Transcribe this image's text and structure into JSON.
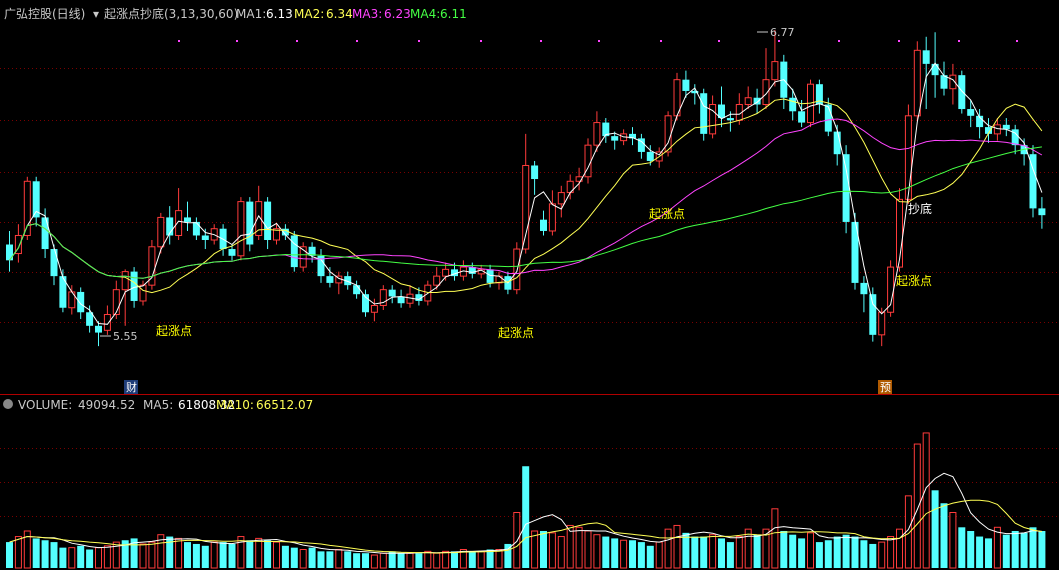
{
  "header": {
    "stock_label": "广弘控股(日线)",
    "indicator_label": "起涨点抄底(3,13,30,60)",
    "ma1_label": "MA1:",
    "ma1_value": "6.13",
    "ma2_label": "MA2:",
    "ma2_value": "6.34",
    "ma3_label": "MA3:",
    "ma3_value": "6.23",
    "ma4_label": "MA4:",
    "ma4_value": "6.11"
  },
  "volume_header": {
    "volume_label": "VOLUME:",
    "volume_value": "49094.52",
    "ma5_label": "MA5:",
    "ma5_value": "61808.32",
    "ma10_label": "MA10:",
    "ma10_value": "66512.07"
  },
  "markers": {
    "fin": "财",
    "pre": "预"
  },
  "colors": {
    "up": "#FF3B3B",
    "down": "#54FFFF",
    "ma1": "#FFFFFF",
    "ma2": "#FFFF55",
    "ma3": "#FF44FF",
    "ma4": "#44FF44",
    "grid": "#7A0000",
    "label_yellow": "#FFFF00",
    "text": "#C8C8C8"
  },
  "chart_data": {
    "type": "candlestick",
    "price_range": [
      5.4,
      6.95
    ],
    "volume_range": [
      0,
      160000
    ],
    "high_label": "6.77",
    "low_label": "5.55",
    "annotations": [
      "起涨点",
      "起涨点",
      "起涨点",
      "起涨点",
      "抄底"
    ],
    "candles": [
      [
        6.0,
        5.93,
        6.06,
        5.88
      ],
      [
        5.96,
        6.04,
        6.09,
        5.92
      ],
      [
        6.04,
        6.28,
        6.3,
        6.02
      ],
      [
        6.28,
        6.12,
        6.3,
        6.08
      ],
      [
        6.12,
        5.98,
        6.16,
        5.94
      ],
      [
        5.98,
        5.86,
        6.0,
        5.82
      ],
      [
        5.86,
        5.72,
        5.89,
        5.7
      ],
      [
        5.72,
        5.79,
        5.82,
        5.69
      ],
      [
        5.79,
        5.7,
        5.81,
        5.67
      ],
      [
        5.7,
        5.64,
        5.73,
        5.61
      ],
      [
        5.64,
        5.61,
        5.66,
        5.55
      ],
      [
        5.62,
        5.69,
        5.73,
        5.6
      ],
      [
        5.69,
        5.8,
        5.84,
        5.67
      ],
      [
        5.8,
        5.88,
        5.89,
        5.64
      ],
      [
        5.88,
        5.75,
        5.9,
        5.72
      ],
      [
        5.75,
        5.82,
        5.84,
        5.73
      ],
      [
        5.82,
        5.99,
        6.02,
        5.8
      ],
      [
        5.99,
        6.12,
        6.14,
        5.96
      ],
      [
        6.12,
        6.04,
        6.17,
        6.0
      ],
      [
        6.04,
        6.15,
        6.25,
        6.02
      ],
      [
        6.12,
        6.1,
        6.19,
        6.06
      ],
      [
        6.1,
        6.04,
        6.12,
        6.02
      ],
      [
        6.04,
        6.02,
        6.07,
        5.98
      ],
      [
        6.02,
        6.07,
        6.09,
        6.0
      ],
      [
        6.07,
        5.98,
        6.09,
        5.95
      ],
      [
        5.98,
        5.95,
        6.0,
        5.93
      ],
      [
        5.95,
        6.19,
        6.21,
        5.93
      ],
      [
        6.19,
        6.0,
        6.21,
        5.97
      ],
      [
        6.04,
        6.19,
        6.26,
        6.02
      ],
      [
        6.19,
        6.02,
        6.21,
        5.98
      ],
      [
        6.02,
        6.07,
        6.09,
        6.0
      ],
      [
        6.07,
        6.04,
        6.09,
        6.02
      ],
      [
        6.04,
        5.9,
        6.06,
        5.88
      ],
      [
        5.9,
        5.99,
        6.01,
        5.88
      ],
      [
        5.99,
        5.95,
        6.01,
        5.92
      ],
      [
        5.95,
        5.86,
        5.98,
        5.83
      ],
      [
        5.86,
        5.83,
        5.9,
        5.81
      ],
      [
        5.83,
        5.86,
        5.88,
        5.78
      ],
      [
        5.86,
        5.82,
        5.88,
        5.8
      ],
      [
        5.82,
        5.78,
        5.84,
        5.76
      ],
      [
        5.78,
        5.7,
        5.8,
        5.68
      ],
      [
        5.7,
        5.73,
        5.76,
        5.66
      ],
      [
        5.73,
        5.8,
        5.82,
        5.71
      ],
      [
        5.8,
        5.77,
        5.82,
        5.74
      ],
      [
        5.77,
        5.74,
        5.8,
        5.72
      ],
      [
        5.74,
        5.78,
        5.82,
        5.72
      ],
      [
        5.78,
        5.75,
        5.81,
        5.73
      ],
      [
        5.75,
        5.82,
        5.84,
        5.73
      ],
      [
        5.82,
        5.86,
        5.9,
        5.8
      ],
      [
        5.86,
        5.89,
        5.92,
        5.84
      ],
      [
        5.89,
        5.86,
        5.92,
        5.84
      ],
      [
        5.86,
        5.9,
        5.93,
        5.84
      ],
      [
        5.9,
        5.87,
        5.92,
        5.85
      ],
      [
        5.87,
        5.89,
        5.91,
        5.85
      ],
      [
        5.89,
        5.83,
        5.91,
        5.81
      ],
      [
        5.83,
        5.86,
        5.88,
        5.8
      ],
      [
        5.86,
        5.8,
        5.88,
        5.78
      ],
      [
        5.8,
        5.98,
        6.01,
        5.78
      ],
      [
        5.98,
        6.35,
        6.49,
        5.96
      ],
      [
        6.35,
        6.29,
        6.37,
        6.22
      ],
      [
        6.11,
        6.06,
        6.15,
        6.04
      ],
      [
        6.06,
        6.18,
        6.24,
        6.04
      ],
      [
        6.18,
        6.23,
        6.26,
        6.12
      ],
      [
        6.23,
        6.28,
        6.31,
        6.2
      ],
      [
        6.28,
        6.3,
        6.34,
        6.24
      ],
      [
        6.3,
        6.44,
        6.47,
        6.27
      ],
      [
        6.44,
        6.54,
        6.59,
        6.41
      ],
      [
        6.54,
        6.48,
        6.56,
        6.45
      ],
      [
        6.48,
        6.46,
        6.5,
        6.42
      ],
      [
        6.46,
        6.49,
        6.51,
        6.44
      ],
      [
        6.49,
        6.47,
        6.52,
        6.44
      ],
      [
        6.47,
        6.41,
        6.49,
        6.38
      ],
      [
        6.41,
        6.37,
        6.44,
        6.35
      ],
      [
        6.37,
        6.41,
        6.43,
        6.34
      ],
      [
        6.41,
        6.57,
        6.59,
        6.39
      ],
      [
        6.57,
        6.73,
        6.76,
        6.55
      ],
      [
        6.73,
        6.68,
        6.77,
        6.65
      ],
      [
        6.68,
        6.67,
        6.71,
        6.62
      ],
      [
        6.67,
        6.49,
        6.69,
        6.46
      ],
      [
        6.49,
        6.62,
        6.66,
        6.47
      ],
      [
        6.62,
        6.56,
        6.7,
        6.52
      ],
      [
        6.56,
        6.55,
        6.59,
        6.5
      ],
      [
        6.55,
        6.62,
        6.67,
        6.53
      ],
      [
        6.62,
        6.65,
        6.7,
        6.6
      ],
      [
        6.65,
        6.62,
        6.69,
        6.58
      ],
      [
        6.62,
        6.73,
        6.87,
        6.6
      ],
      [
        6.73,
        6.81,
        6.95,
        6.7
      ],
      [
        6.81,
        6.65,
        6.84,
        6.6
      ],
      [
        6.65,
        6.59,
        6.69,
        6.55
      ],
      [
        6.59,
        6.54,
        6.64,
        6.52
      ],
      [
        6.54,
        6.71,
        6.73,
        6.52
      ],
      [
        6.71,
        6.62,
        6.73,
        6.58
      ],
      [
        6.62,
        6.5,
        6.65,
        6.48
      ],
      [
        6.5,
        6.4,
        6.53,
        6.35
      ],
      [
        6.4,
        6.1,
        6.44,
        6.05
      ],
      [
        6.1,
        5.83,
        6.14,
        5.8
      ],
      [
        5.83,
        5.78,
        5.86,
        5.7
      ],
      [
        5.78,
        5.6,
        5.81,
        5.57
      ],
      [
        5.6,
        5.7,
        5.72,
        5.55
      ],
      [
        5.7,
        5.9,
        5.93,
        5.68
      ],
      [
        5.9,
        6.2,
        6.25,
        5.88
      ],
      [
        6.2,
        6.57,
        6.62,
        6.18
      ],
      [
        6.57,
        6.86,
        6.9,
        6.55
      ],
      [
        6.86,
        6.8,
        6.92,
        6.6
      ],
      [
        6.8,
        6.75,
        6.94,
        6.65
      ],
      [
        6.75,
        6.69,
        6.81,
        6.66
      ],
      [
        6.69,
        6.75,
        6.8,
        6.62
      ],
      [
        6.75,
        6.6,
        6.77,
        6.58
      ],
      [
        6.6,
        6.57,
        6.64,
        6.52
      ],
      [
        6.57,
        6.52,
        6.6,
        6.47
      ],
      [
        6.52,
        6.49,
        6.56,
        6.45
      ],
      [
        6.49,
        6.53,
        6.56,
        6.46
      ],
      [
        6.53,
        6.51,
        6.56,
        6.48
      ],
      [
        6.51,
        6.44,
        6.53,
        6.4
      ],
      [
        6.44,
        6.4,
        6.47,
        6.35
      ],
      [
        6.4,
        6.16,
        6.44,
        6.12
      ],
      [
        6.16,
        6.13,
        6.21,
        6.07
      ]
    ],
    "volumes": [
      [
        28000,
        "d"
      ],
      [
        34000,
        "u"
      ],
      [
        40000,
        "u"
      ],
      [
        32000,
        "d"
      ],
      [
        30000,
        "d"
      ],
      [
        28000,
        "d"
      ],
      [
        22000,
        "d"
      ],
      [
        22000,
        "u"
      ],
      [
        24000,
        "d"
      ],
      [
        20000,
        "d"
      ],
      [
        22000,
        "u"
      ],
      [
        24000,
        "u"
      ],
      [
        28000,
        "u"
      ],
      [
        30000,
        "d"
      ],
      [
        32000,
        "d"
      ],
      [
        26000,
        "u"
      ],
      [
        28000,
        "u"
      ],
      [
        36000,
        "u"
      ],
      [
        34000,
        "d"
      ],
      [
        32000,
        "u"
      ],
      [
        28000,
        "d"
      ],
      [
        26000,
        "d"
      ],
      [
        24000,
        "d"
      ],
      [
        28000,
        "u"
      ],
      [
        28000,
        "d"
      ],
      [
        26000,
        "d"
      ],
      [
        34000,
        "u"
      ],
      [
        30000,
        "d"
      ],
      [
        32000,
        "u"
      ],
      [
        30000,
        "d"
      ],
      [
        28000,
        "u"
      ],
      [
        24000,
        "d"
      ],
      [
        22000,
        "d"
      ],
      [
        20000,
        "u"
      ],
      [
        22000,
        "d"
      ],
      [
        18000,
        "d"
      ],
      [
        18000,
        "d"
      ],
      [
        20000,
        "u"
      ],
      [
        18000,
        "d"
      ],
      [
        16000,
        "d"
      ],
      [
        16000,
        "d"
      ],
      [
        14000,
        "u"
      ],
      [
        16000,
        "u"
      ],
      [
        18000,
        "d"
      ],
      [
        16000,
        "d"
      ],
      [
        16000,
        "u"
      ],
      [
        16000,
        "d"
      ],
      [
        18000,
        "u"
      ],
      [
        16000,
        "u"
      ],
      [
        18000,
        "u"
      ],
      [
        18000,
        "d"
      ],
      [
        20000,
        "u"
      ],
      [
        18000,
        "d"
      ],
      [
        18000,
        "u"
      ],
      [
        20000,
        "d"
      ],
      [
        20000,
        "u"
      ],
      [
        26000,
        "d"
      ],
      [
        60000,
        "u"
      ],
      [
        110000,
        "d"
      ],
      [
        40000,
        "u"
      ],
      [
        40000,
        "d"
      ],
      [
        38000,
        "u"
      ],
      [
        34000,
        "u"
      ],
      [
        46000,
        "u"
      ],
      [
        44000,
        "u"
      ],
      [
        40000,
        "u"
      ],
      [
        36000,
        "u"
      ],
      [
        34000,
        "d"
      ],
      [
        32000,
        "d"
      ],
      [
        30000,
        "u"
      ],
      [
        30000,
        "d"
      ],
      [
        28000,
        "d"
      ],
      [
        24000,
        "d"
      ],
      [
        28000,
        "u"
      ],
      [
        42000,
        "u"
      ],
      [
        46000,
        "u"
      ],
      [
        38000,
        "d"
      ],
      [
        34000,
        "d"
      ],
      [
        34000,
        "d"
      ],
      [
        36000,
        "u"
      ],
      [
        32000,
        "d"
      ],
      [
        28000,
        "d"
      ],
      [
        34000,
        "u"
      ],
      [
        42000,
        "u"
      ],
      [
        36000,
        "d"
      ],
      [
        42000,
        "u"
      ],
      [
        64000,
        "u"
      ],
      [
        40000,
        "d"
      ],
      [
        36000,
        "d"
      ],
      [
        32000,
        "d"
      ],
      [
        38000,
        "u"
      ],
      [
        28000,
        "d"
      ],
      [
        30000,
        "d"
      ],
      [
        34000,
        "d"
      ],
      [
        36000,
        "d"
      ],
      [
        34000,
        "d"
      ],
      [
        30000,
        "d"
      ],
      [
        26000,
        "d"
      ],
      [
        28000,
        "u"
      ],
      [
        34000,
        "u"
      ],
      [
        42000,
        "u"
      ],
      [
        78000,
        "u"
      ],
      [
        134000,
        "u"
      ],
      [
        146000,
        "u"
      ],
      [
        84000,
        "d"
      ],
      [
        70000,
        "d"
      ],
      [
        60000,
        "u"
      ],
      [
        44000,
        "d"
      ],
      [
        40000,
        "d"
      ],
      [
        34000,
        "d"
      ],
      [
        32000,
        "d"
      ],
      [
        44000,
        "u"
      ],
      [
        36000,
        "d"
      ],
      [
        40000,
        "d"
      ],
      [
        38000,
        "d"
      ],
      [
        44000,
        "d"
      ],
      [
        40000,
        "d"
      ]
    ]
  }
}
